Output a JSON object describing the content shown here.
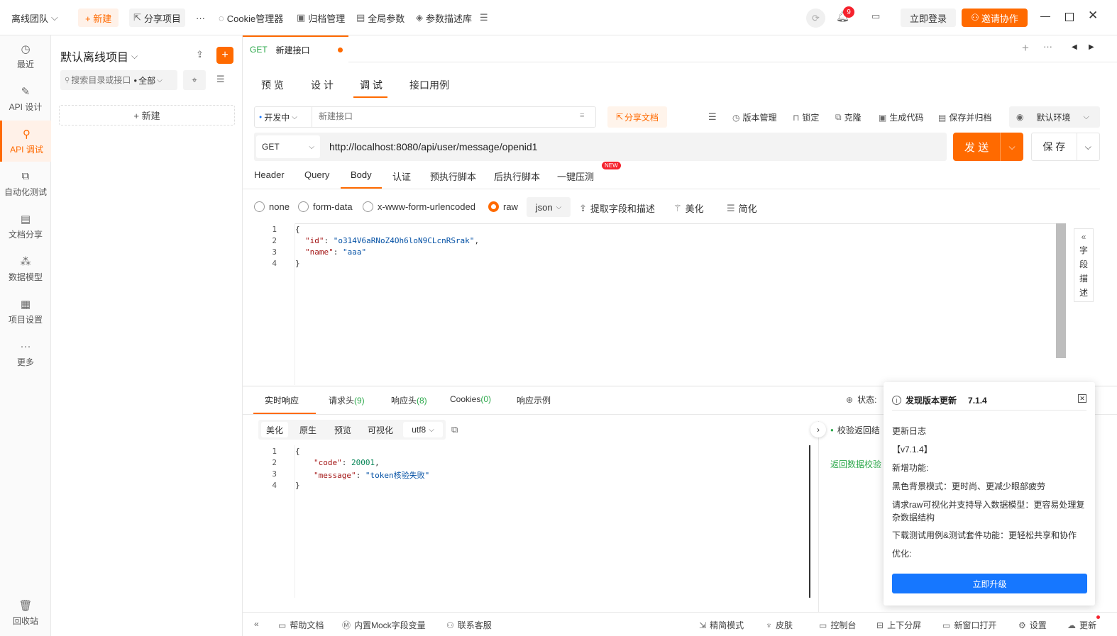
{
  "topbar": {
    "team": "离线团队",
    "new_btn": "+ 新建",
    "share_project": "分享项目",
    "more": "···",
    "cookie": "Cookie管理器",
    "archive": "归档管理",
    "global_params": "全局参数",
    "param_lib": "参数描述库",
    "notif_count": "9",
    "login": "立即登录",
    "invite": "邀请协作"
  },
  "leftnav": {
    "items": [
      {
        "label": "最近",
        "icon": "clock-icon"
      },
      {
        "label": "API 设计",
        "icon": "edit-icon"
      },
      {
        "label": "API 调试",
        "icon": "debug-icon"
      },
      {
        "label": "自动化测试",
        "icon": "flow-icon"
      },
      {
        "label": "文档分享",
        "icon": "doc-icon"
      },
      {
        "label": "数据模型",
        "icon": "model-icon"
      },
      {
        "label": "项目设置",
        "icon": "settings-icon"
      },
      {
        "label": "更多",
        "icon": "more-icon"
      }
    ],
    "trash": "回收站"
  },
  "tree": {
    "project": "默认离线项目",
    "search_placeholder": "搜索目录或接口",
    "filter": "全部",
    "new_btn": "+ 新建"
  },
  "tab": {
    "method": "GET",
    "name": "新建接口"
  },
  "modes": [
    "预 览",
    "设 计",
    "调 试",
    "接口用例"
  ],
  "toolbar": {
    "env_status": "开发中",
    "name_placeholder": "新建接口",
    "share_doc": "分享文档",
    "version": "版本管理",
    "lock": "锁定",
    "clone": "克隆",
    "gen_code": "生成代码",
    "save_archive": "保存并归档",
    "env": "默认环境"
  },
  "request": {
    "method": "GET",
    "url": "http://localhost:8080/api/user/message/openid1",
    "send": "发 送",
    "save": "保 存"
  },
  "req_tabs": [
    "Header",
    "Query",
    "Body",
    "认证",
    "预执行脚本",
    "后执行脚本",
    "一键压测"
  ],
  "new_badge": "NEW",
  "body_opts": {
    "none": "none",
    "form_data": "form-data",
    "urlencoded": "x-www-form-urlencoded",
    "raw": "raw",
    "format": "json",
    "extract": "提取字段和描述",
    "beautify": "美化",
    "simplify": "简化"
  },
  "body_code": {
    "lines": [
      "1",
      "2",
      "3",
      "4"
    ],
    "l1": "{",
    "l2k": "\"id\"",
    "l2v": "\"o314V6aRNoZ4Oh6loN9CLcnRSrak\"",
    "l3k": "\"name\"",
    "l3v": "\"aaa\"",
    "l4": "}"
  },
  "field_desc": [
    "字",
    "段",
    "描",
    "述"
  ],
  "resp_tabs": {
    "realtime": "实时响应",
    "req_headers": "请求头",
    "req_headers_count": "(9)",
    "resp_headers": "响应头",
    "resp_headers_count": "(8)",
    "cookies": "Cookies",
    "cookies_count": "(0)",
    "example": "响应示例",
    "status_label": "状态:"
  },
  "resp_view": {
    "beautify": "美化",
    "raw": "原生",
    "preview": "预览",
    "visual": "可视化",
    "encoding": "utf8"
  },
  "resp_code": {
    "lines": [
      "1",
      "2",
      "3",
      "4"
    ],
    "l1": "{",
    "l2k": "\"code\"",
    "l2v": "20001",
    "l3k": "\"message\"",
    "l3v": "\"token核验失败\"",
    "l4": "}"
  },
  "validate": {
    "title": "校验返回结",
    "result": "返回数据校验"
  },
  "update_popup": {
    "title": "发现版本更新",
    "version": "7.1.4",
    "log_title": "更新日志",
    "ver_tag": "【v7.1.4】",
    "new_features": "新增功能:",
    "f1": "黑色背景模式：更时尚、更减少眼部疲劳",
    "f2": "请求raw可视化并支持导入数据模型：更容易处理复杂数据结构",
    "f3": "下载测试用例&测试套件功能：更轻松共享和协作",
    "optimize": "优化:",
    "upgrade": "立即升级"
  },
  "bottombar": {
    "help": "帮助文档",
    "mock": "内置Mock字段变量",
    "support": "联系客服",
    "simple": "精简模式",
    "skin": "皮肤",
    "console": "控制台",
    "split": "上下分屏",
    "new_window": "新窗口打开",
    "settings": "设置",
    "update": "更新"
  },
  "colors": {
    "accent": "#ff6a00",
    "blue": "#1677ff",
    "green": "#2ba84a"
  }
}
